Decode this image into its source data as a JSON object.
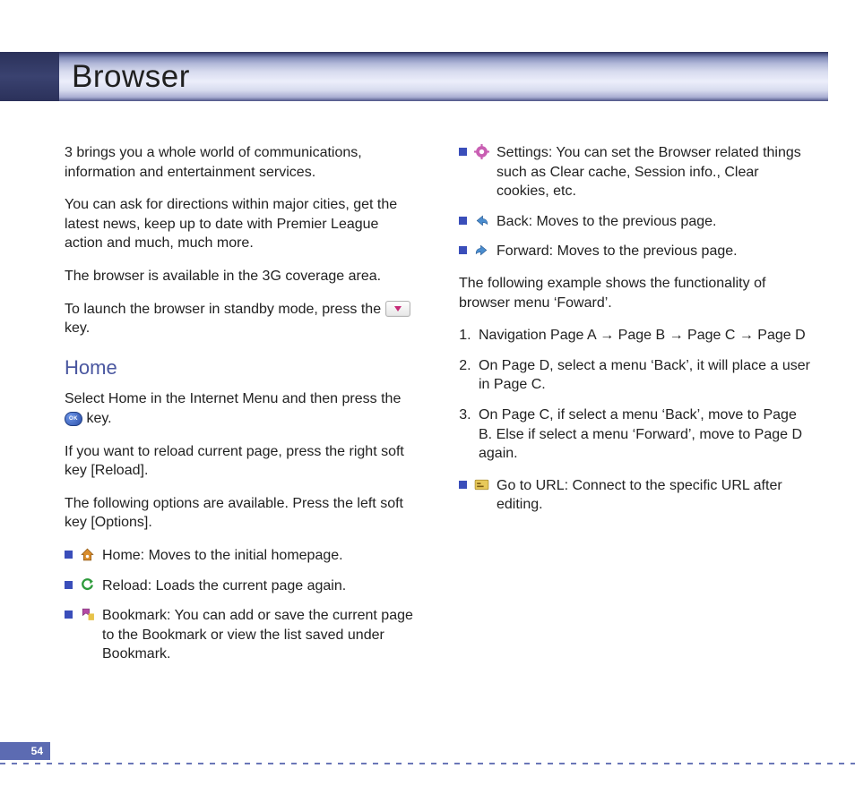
{
  "header": {
    "title": "Browser"
  },
  "footer": {
    "pageNumber": "54"
  },
  "left": {
    "p1": "3 brings you a whole world of communications, information and entertainment services.",
    "p2": "You can ask for directions within major cities, get the latest news, keep up to date with Premier League action and much, much more.",
    "p3": "The browser is available in the 3G coverage area.",
    "p4a": "To launch the browser in standby mode, press the ",
    "p4b": " key.",
    "homeHeading": "Home",
    "p5a": "Select Home in the Internet Menu and then press the ",
    "p5b": " key.",
    "okLabel": "OK",
    "p6": "If you want to reload current page, press the right soft key [Reload].",
    "p7": "The following options are available. Press the left soft key [Options].",
    "opts": [
      {
        "icon": "home-icon",
        "text": "Home: Moves to the initial homepage."
      },
      {
        "icon": "reload-icon",
        "text": "Reload: Loads the current page again."
      },
      {
        "icon": "bookmark-icon",
        "text": "Bookmark: You can add or save the current page to the Bookmark or view the list saved under Bookmark."
      }
    ]
  },
  "right": {
    "opts": [
      {
        "icon": "settings-icon",
        "text": "Settings: You can set the Browser related things such as Clear cache, Session info., Clear cookies, etc."
      },
      {
        "icon": "back-icon",
        "text": "Back: Moves to the previous page."
      },
      {
        "icon": "forward-icon",
        "text": "Forward: Moves to the previous page."
      }
    ],
    "p1": "The following example shows the functionality of browser menu ‘Foward’.",
    "steps": [
      "Navigation Page A →  Page B →  Page C → Page D",
      "On Page D, select a menu ‘Back’, it will place a user in Page C.",
      "On Page C, if select a menu ‘Back’, move to Page B. Else if select a menu ‘Forward’, move to Page D again."
    ],
    "opts2": [
      {
        "icon": "url-icon",
        "text": "Go to URL: Connect to the specific URL after editing."
      }
    ]
  }
}
